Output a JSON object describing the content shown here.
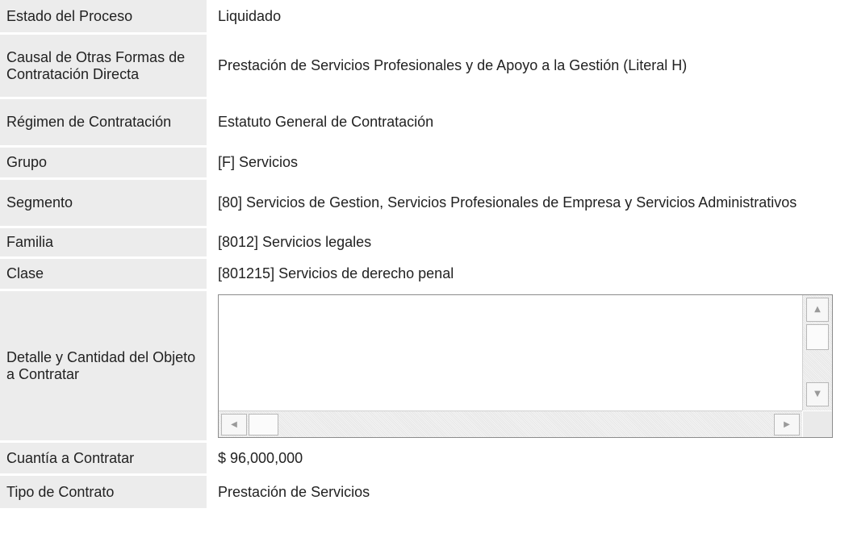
{
  "rows": {
    "estado": {
      "label": "Estado del Proceso",
      "value": "Liquidado"
    },
    "causal": {
      "label": "Causal de Otras Formas de Contratación Directa",
      "value": "Prestación de Servicios Profesionales y de Apoyo a la Gestión (Literal H)"
    },
    "regimen": {
      "label": "Régimen de Contratación",
      "value": "Estatuto General de Contratación"
    },
    "grupo": {
      "label": "Grupo",
      "value": "[F] Servicios"
    },
    "segmento": {
      "label": "Segmento",
      "value": "[80] Servicios de Gestion, Servicios Profesionales de Empresa y Servicios Administrativos"
    },
    "familia": {
      "label": "Familia",
      "value": "[8012] Servicios legales"
    },
    "clase": {
      "label": "Clase",
      "value": "[801215] Servicios de derecho penal"
    },
    "detalle": {
      "label": "Detalle y Cantidad del Objeto a Contratar",
      "value": ""
    },
    "cuantia": {
      "label": "Cuantía a Contratar",
      "value": "$ 96,000,000"
    },
    "tipo": {
      "label": "Tipo de Contrato",
      "value": "Prestación de Servicios"
    }
  },
  "icons": {
    "scroll_up": "▲",
    "scroll_down": "▼",
    "scroll_left": "◀",
    "scroll_right": "▶"
  },
  "colors": {
    "label_background": "#ececec",
    "text": "#222222"
  }
}
